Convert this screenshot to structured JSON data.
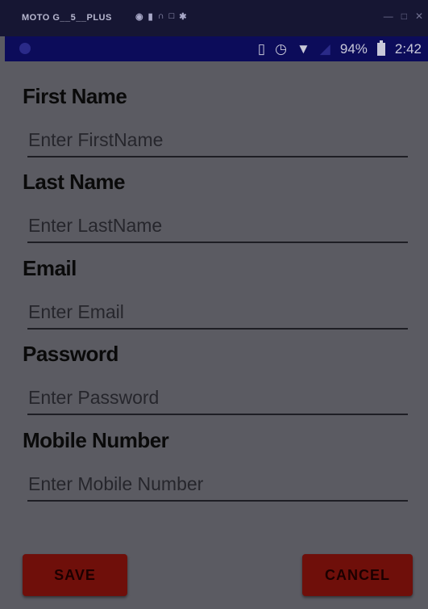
{
  "titlebar": {
    "device_name": "MOTO G__5__PLUS",
    "tool_icons": [
      "camera-icon",
      "video-icon",
      "headset-icon",
      "fullscreen-icon",
      "settings-icon"
    ],
    "window_controls": [
      "minimize",
      "maximize",
      "close"
    ]
  },
  "statusbar": {
    "battery_percent": "94%",
    "time": "2:42",
    "icons": [
      "vibrate-icon",
      "alarm-icon",
      "wifi-icon",
      "signal-icon",
      "battery-icon"
    ]
  },
  "form": {
    "first_name": {
      "label": "First Name",
      "placeholder": "Enter FirstName"
    },
    "last_name": {
      "label": "Last Name",
      "placeholder": "Enter LastName"
    },
    "email": {
      "label": "Email",
      "placeholder": "Enter Email"
    },
    "password": {
      "label": "Password",
      "placeholder": "Enter Password"
    },
    "mobile": {
      "label": "Mobile Number",
      "placeholder": "Enter Mobile Number"
    }
  },
  "buttons": {
    "save": "SAVE",
    "cancel": "CANCEL"
  },
  "colors": {
    "button_bg": "#6f0f0a",
    "statusbar_bg": "#0c0c5a",
    "screen_bg": "#5b5b62"
  }
}
